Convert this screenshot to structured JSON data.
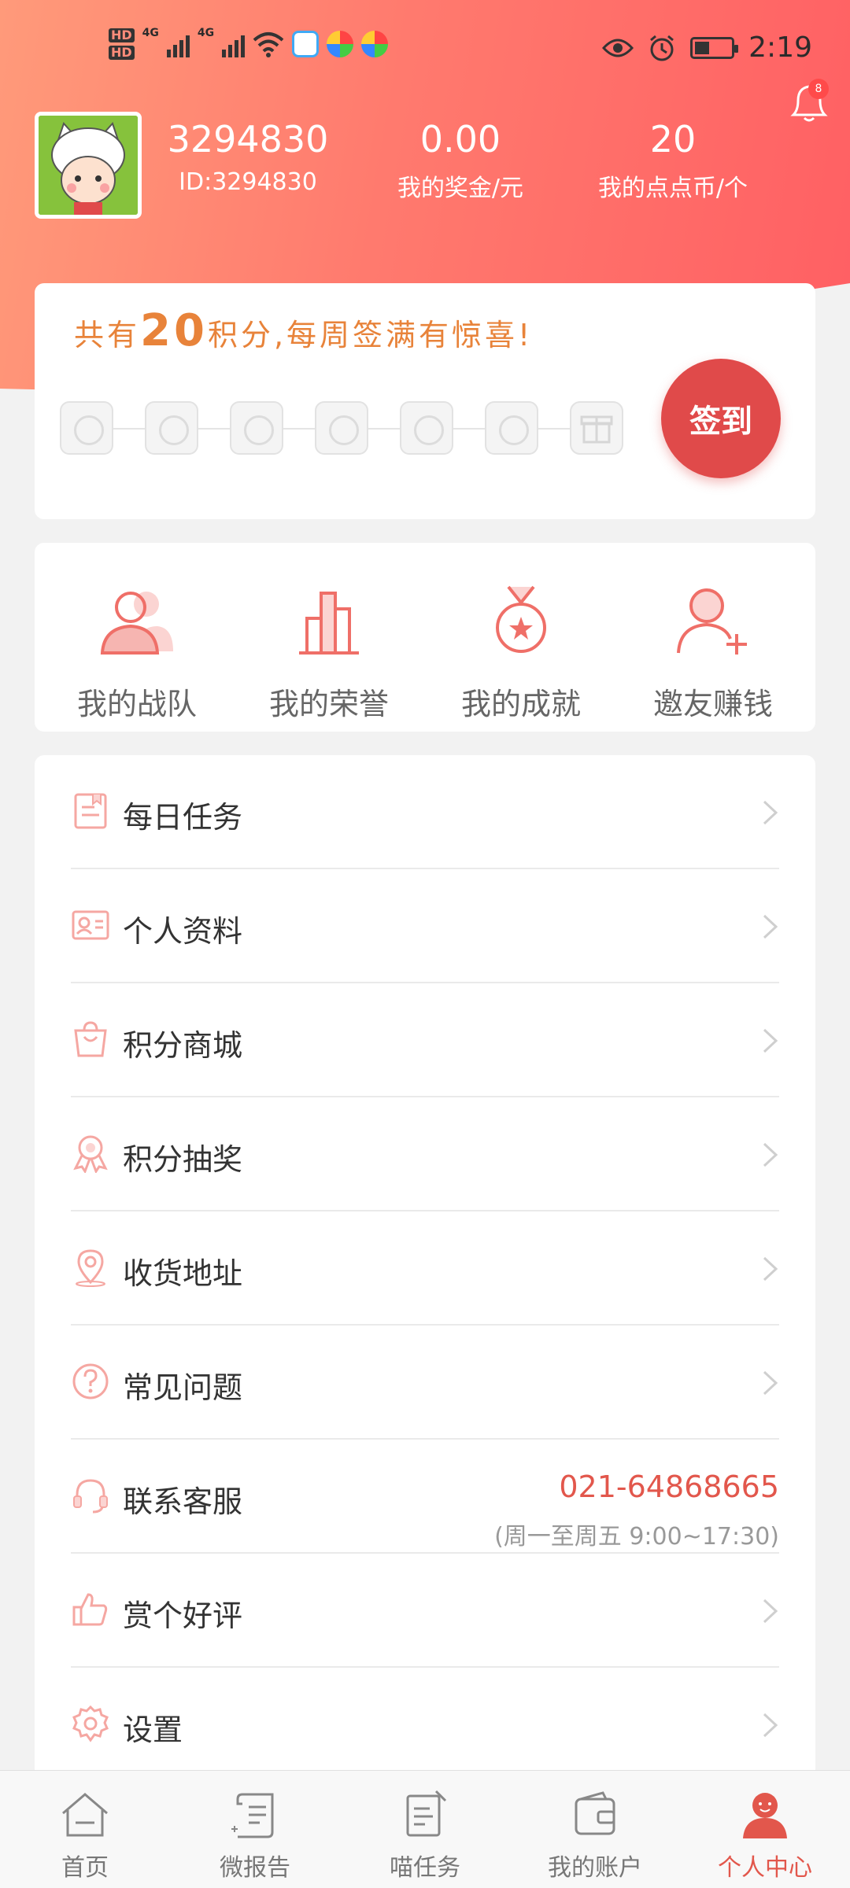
{
  "status_bar": {
    "network_1": "4G",
    "network_2": "4G",
    "hd_1": "HD",
    "hd_2": "HD",
    "time": "2:19"
  },
  "notifications": {
    "badge": "8"
  },
  "profile": {
    "name": "3294830",
    "id_text": "ID:3294830",
    "bonus_value": "0.00",
    "bonus_label": "我的奖金/元",
    "coins_value": "20",
    "coins_label": "我的点点币/个"
  },
  "signin": {
    "prefix": "共有",
    "points": "20",
    "suffix": "积分,每周签满有惊喜!",
    "button": "签到"
  },
  "quick_actions": [
    {
      "label": "我的战队",
      "icon": "team-icon"
    },
    {
      "label": "我的荣誉",
      "icon": "honor-icon"
    },
    {
      "label": "我的成就",
      "icon": "medal-icon"
    },
    {
      "label": "邀友赚钱",
      "icon": "invite-icon"
    }
  ],
  "menu": [
    {
      "label": "每日任务",
      "icon": "task-icon"
    },
    {
      "label": "个人资料",
      "icon": "profile-card-icon"
    },
    {
      "label": "积分商城",
      "icon": "shopping-bag-icon"
    },
    {
      "label": "积分抽奖",
      "icon": "ribbon-icon"
    },
    {
      "label": "收货地址",
      "icon": "location-icon"
    },
    {
      "label": "常见问题",
      "icon": "question-icon"
    },
    {
      "label": "联系客服",
      "icon": "headset-icon",
      "phone": "021-64868665",
      "hours": "(周一至周五 9:00~17:30)"
    },
    {
      "label": "赏个好评",
      "icon": "thumbs-up-icon"
    },
    {
      "label": "设置",
      "icon": "gear-icon"
    }
  ],
  "nav": [
    {
      "label": "首页",
      "icon": "home-icon"
    },
    {
      "label": "微报告",
      "icon": "report-icon"
    },
    {
      "label": "喵任务",
      "icon": "mission-icon"
    },
    {
      "label": "我的账户",
      "icon": "wallet-icon"
    },
    {
      "label": "个人中心",
      "icon": "person-icon",
      "active": true
    }
  ],
  "colors": {
    "accent": "#e2574c",
    "gradient_start": "#ff9a7a",
    "gradient_end": "#ff5f63",
    "signin_text": "#e8833a"
  }
}
